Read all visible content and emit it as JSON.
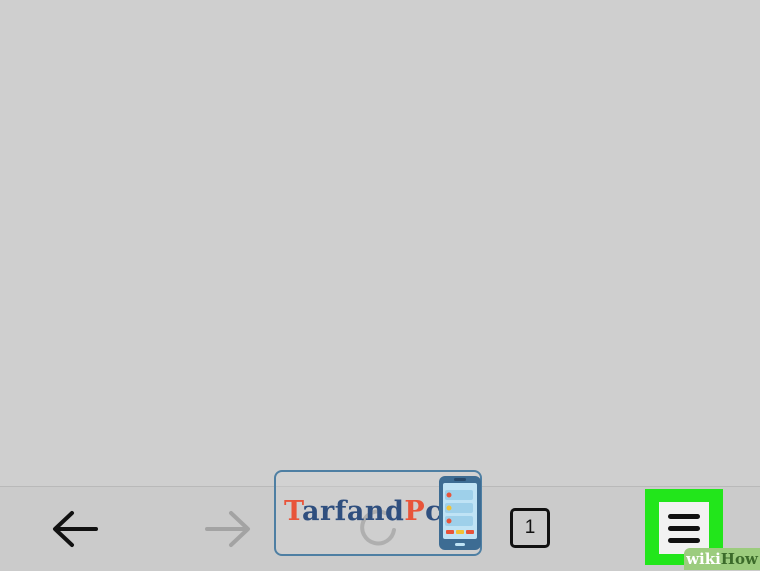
{
  "toolbar": {
    "back_icon": "back-arrow-icon",
    "forward_icon": "forward-arrow-icon",
    "reload_icon": "reload-spinner-icon",
    "tab_count": "1",
    "menu_icon": "hamburger-menu-icon",
    "highlight_color": "#22e61b"
  },
  "watermark": {
    "brand_first": "T",
    "brand_mid": "arfand",
    "brand_p": "P",
    "brand_end": "c"
  },
  "credit": {
    "part1": "wiki",
    "part2": "How"
  }
}
